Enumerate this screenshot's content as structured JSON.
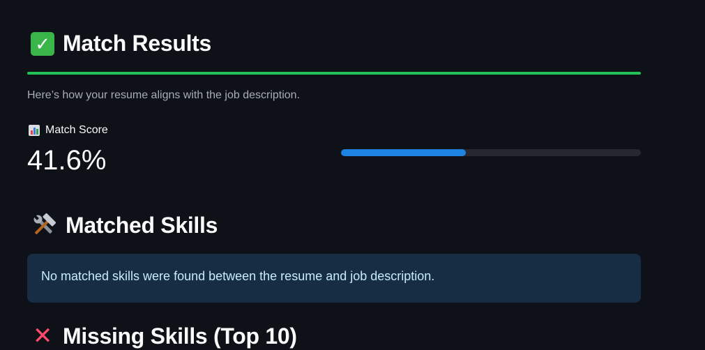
{
  "results": {
    "title": "Match Results",
    "title_icon": "check-mark-button-icon",
    "caption": "Here’s how your resume aligns with the job description."
  },
  "metric": {
    "label": "Match Score",
    "label_icon": "bar-chart-icon",
    "value": "41.6%",
    "progress_fraction": 0.416
  },
  "matched": {
    "title": "Matched Skills",
    "title_icon": "hammer-and-wrench-icon",
    "message": "No matched skills were found between the resume and job description."
  },
  "missing": {
    "title": "Missing Skills (Top 10)",
    "title_icon": "cross-mark-icon"
  },
  "colors": {
    "background": "#0e1117",
    "divider": "#21c354",
    "progress": "#1c83e1",
    "info_bg": "#172d43",
    "info_text": "#c7ebff"
  }
}
